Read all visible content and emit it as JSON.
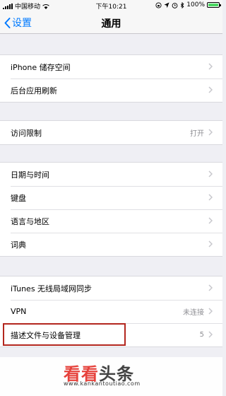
{
  "status_bar": {
    "carrier": "中国移动",
    "time": "下午10:21",
    "battery_text": "100%",
    "battery_level": 1.0,
    "battery_color": "#4cd964"
  },
  "nav": {
    "back_label": "设置",
    "title": "通用",
    "accent_color": "#007aff"
  },
  "groups": [
    [
      {
        "label": "iPhone 储存空间",
        "value": ""
      },
      {
        "label": "后台应用刷新",
        "value": ""
      }
    ],
    [
      {
        "label": "访问限制",
        "value": "打开"
      }
    ],
    [
      {
        "label": "日期与时间",
        "value": ""
      },
      {
        "label": "键盘",
        "value": ""
      },
      {
        "label": "语言与地区",
        "value": ""
      },
      {
        "label": "词典",
        "value": ""
      }
    ],
    [
      {
        "label": "iTunes 无线局域网同步",
        "value": ""
      },
      {
        "label": "VPN",
        "value": "未连接"
      },
      {
        "label": "描述文件与设备管理",
        "value": "5"
      }
    ]
  ],
  "watermark": {
    "logo_part1": "看看",
    "logo_part2": "头条",
    "url": "www.kankantoutiao.com"
  },
  "icons": [
    "signal-icon",
    "wifi-icon",
    "lock-rotation-icon",
    "location-icon",
    "alarm-icon",
    "bluetooth-icon",
    "battery-icon",
    "back-chevron-icon",
    "chevron-right-icon"
  ]
}
